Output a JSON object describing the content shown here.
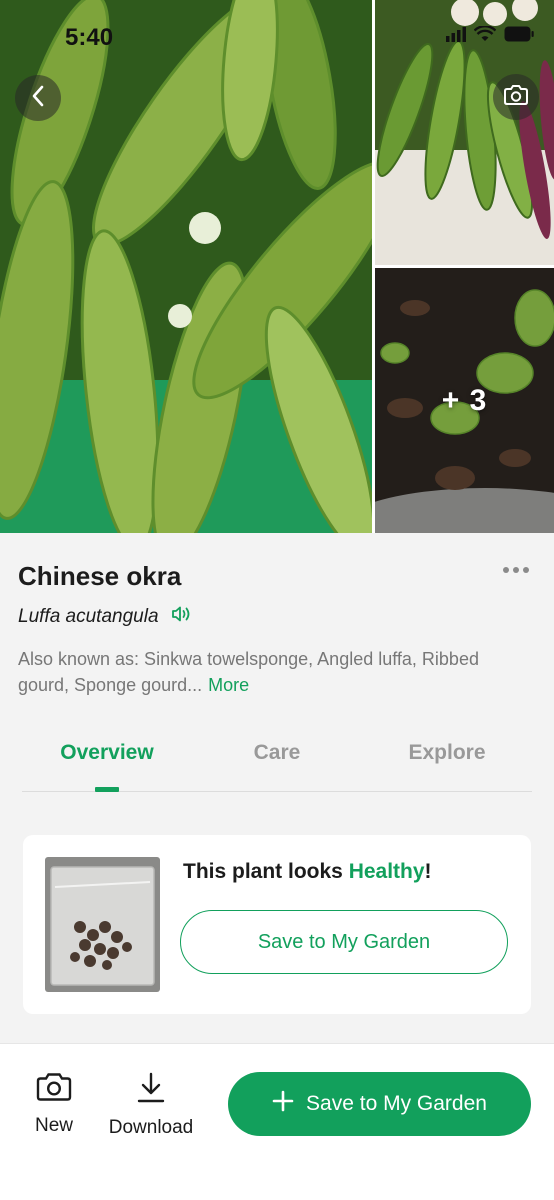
{
  "status_bar": {
    "time": "5:40"
  },
  "gallery": {
    "more_count": "+ 3"
  },
  "plant": {
    "common_name": "Chinese okra",
    "latin_name": "Luffa acutangula",
    "also_known_as": "Also known as: Sinkwa towelsponge, Angled luffa, Ribbed gourd, Sponge gourd...",
    "more_link": "More"
  },
  "tabs": [
    {
      "label": "Overview",
      "active": true
    },
    {
      "label": "Care",
      "active": false
    },
    {
      "label": "Explore",
      "active": false
    }
  ],
  "health_card": {
    "prefix": "This plant looks ",
    "status": "Healthy",
    "suffix": "!",
    "save_button": "Save to My Garden"
  },
  "bottom_bar": {
    "new_label": "New",
    "download_label": "Download",
    "primary_button": "Save to My Garden"
  },
  "colors": {
    "accent": "#12a05c",
    "text": "#1c1c1c",
    "muted": "#777777"
  },
  "icons": [
    "back-icon",
    "camera-icon",
    "speaker-icon",
    "more-icon",
    "wifi-icon",
    "battery-icon",
    "signal-icon",
    "download-icon",
    "plus-icon"
  ]
}
